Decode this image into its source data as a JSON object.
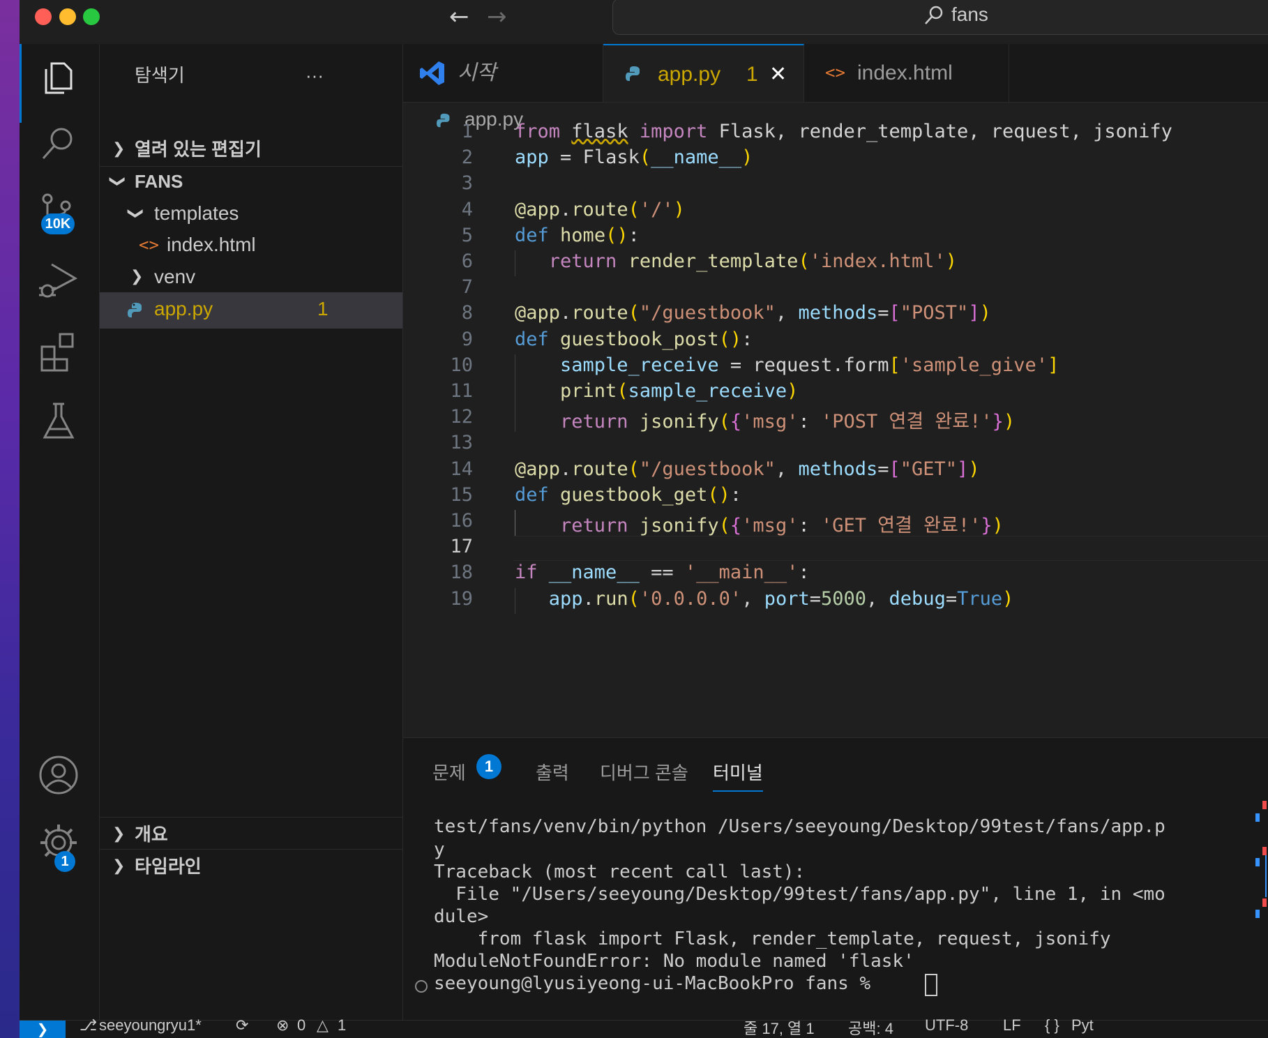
{
  "titlebar": {
    "search_text": "fans"
  },
  "activity": {
    "scm_badge": "10K",
    "settings_badge": "1"
  },
  "sidebar": {
    "title": "탐색기",
    "more": "···",
    "open_editors": "열려 있는 편집기",
    "root": "FANS",
    "templates": "templates",
    "index_html": "index.html",
    "venv": "venv",
    "app_py": "app.py",
    "app_py_count": "1",
    "outline": "개요",
    "timeline": "타임라인"
  },
  "tabs": [
    {
      "label": "시작"
    },
    {
      "label": "app.py",
      "count": "1"
    },
    {
      "label": "index.html"
    }
  ],
  "breadcrumb": "app.py",
  "code_lines": [
    "1",
    "2",
    "3",
    "4",
    "5",
    "6",
    "7",
    "8",
    "9",
    "10",
    "11",
    "12",
    "13",
    "14",
    "15",
    "16",
    "17",
    "18",
    "19"
  ],
  "panel": {
    "tabs": [
      "문제",
      "출력",
      "디버그 콘솔",
      "터미널"
    ],
    "problems_count": "1",
    "terminal_lines": [
      "test/fans/venv/bin/python /Users/seeyoung/Desktop/99test/fans/app.p",
      "y",
      "Traceback (most recent call last):",
      "  File \"/Users/seeyoung/Desktop/99test/fans/app.py\", line 1, in <mo",
      "dule>",
      "    from flask import Flask, render_template, request, jsonify",
      "ModuleNotFoundError: No module named 'flask'",
      "seeyoung@lyusiyeong-ui-MacBookPro fans % "
    ]
  },
  "status": {
    "branch": "seeyoungryu1*",
    "errors": "0",
    "warnings": "1",
    "position": "줄 17, 열 1",
    "spaces": "공백: 4",
    "encoding": "UTF-8",
    "eol": "LF",
    "language": "Pyt"
  }
}
